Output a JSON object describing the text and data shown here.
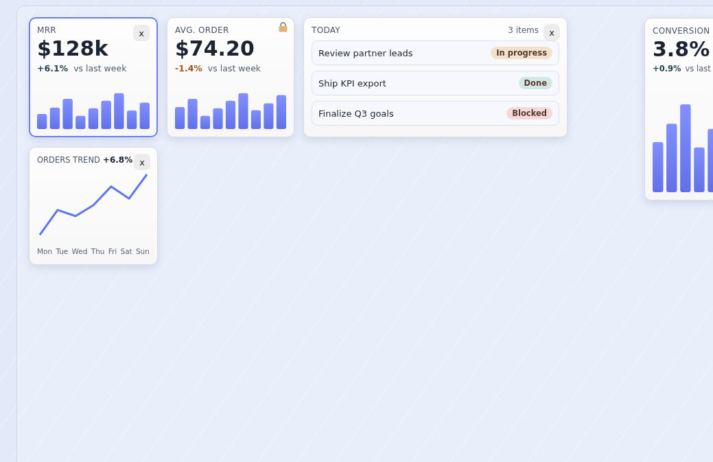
{
  "widgets": [
    {
      "kind": "metric",
      "title": "MRR",
      "value": "$128k",
      "delta": "+6.1%",
      "negative": false,
      "note": "vs last week",
      "selected": true,
      "locked": false,
      "closable": true,
      "close_label": "x"
    },
    {
      "kind": "metric",
      "title": "AVG. ORDER",
      "value": "$74.20",
      "delta": "-1.4%",
      "negative": true,
      "note": "vs last week",
      "selected": false,
      "locked": true,
      "closable": false
    },
    {
      "kind": "tasks",
      "title": "TODAY",
      "count": "3 items",
      "selected": false,
      "locked": false,
      "closable": true,
      "close_label": "x",
      "items": [
        {
          "label": "Review partner leads",
          "status": "In progress",
          "color": "#efe3cc"
        },
        {
          "label": "Ship KPI export",
          "status": "Done",
          "color": "#d3e8e3"
        },
        {
          "label": "Finalize Q3 goals",
          "status": "Blocked",
          "color": "#f3d9d9"
        }
      ]
    },
    {
      "kind": "metric",
      "title": "CONVERSION",
      "value": "3.8%",
      "delta": "+0.9%",
      "negative": false,
      "note": "vs last",
      "selected": false,
      "locked": false,
      "closable": false,
      "tall": true
    },
    {
      "kind": "trend",
      "title": "ORDERS TREND",
      "delta": "+6.8%",
      "selected": false,
      "locked": false,
      "closable": true,
      "close_label": "x",
      "x_labels": [
        "Mon",
        "Tue",
        "Wed",
        "Thu",
        "Fri",
        "Sat",
        "Sun"
      ]
    }
  ]
}
